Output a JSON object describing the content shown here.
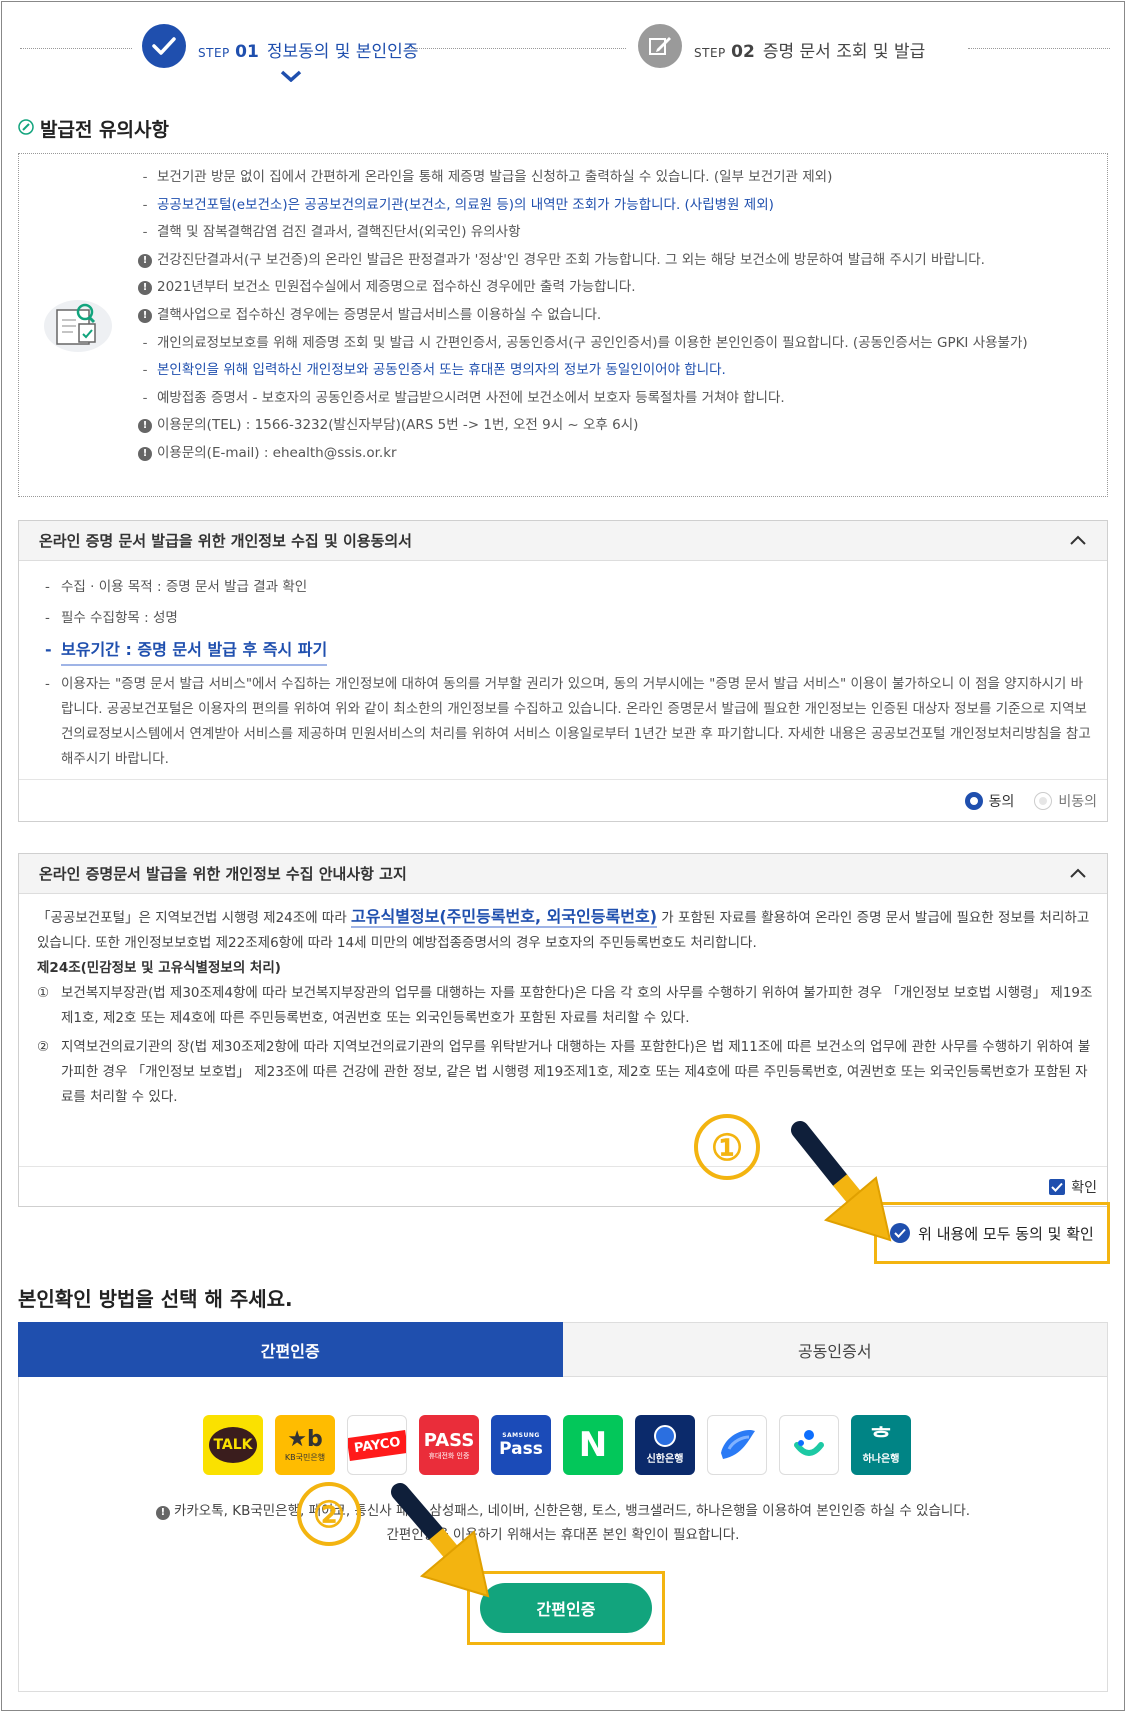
{
  "steps": [
    {
      "prefix": "STEP",
      "num": "01",
      "label": "정보동의 및 본인인증",
      "active": true
    },
    {
      "prefix": "STEP",
      "num": "02",
      "label": "증명 문서 조회 및 발급",
      "active": false
    }
  ],
  "notice": {
    "title": "발급전 유의사항",
    "items": [
      {
        "type": "dash",
        "text": "보건기관 방문 없이 집에서 간편하게 온라인을 통해 제증명 발급을 신청하고 출력하실 수 있습니다. (일부 보건기관 제외)"
      },
      {
        "type": "dash-blue",
        "text": "공공보건포털(e보건소)은 공공보건의료기관(보건소, 의료원 등)의 내역만 조회가 가능합니다. (사립병원 제외)"
      },
      {
        "type": "dash",
        "text": "결핵 및 잠복결핵감염 검진 결과서, 결핵진단서(외국인) 유의사항"
      },
      {
        "type": "alert",
        "text": "건강진단결과서(구 보건증)의 온라인 발급은 판정결과가 '정상'인 경우만 조회 가능합니다. 그 외는 해당 보건소에 방문하여 발급해 주시기 바랍니다."
      },
      {
        "type": "alert",
        "text": "2021년부터 보건소 민원접수실에서 제증명으로 접수하신 경우에만 출력 가능합니다."
      },
      {
        "type": "alert",
        "text": "결핵사업으로 접수하신 경우에는 증명문서 발급서비스를 이용하실 수 없습니다."
      },
      {
        "type": "dash",
        "text": "개인의료정보보호를 위해 제증명 조회 및 발급 시 간편인증서, 공동인증서(구 공인인증서)를 이용한 본인인증이 필요합니다. (공동인증서는 GPKI 사용불가)"
      },
      {
        "type": "dash-blue",
        "text": "본인확인을 위해 입력하신 개인정보와 공동인증서 또는 휴대폰 명의자의 정보가 동일인이어야 합니다."
      },
      {
        "type": "dash",
        "text": "예방접종 증명서 - 보호자의 공동인증서로 발급받으시려면 사전에 보건소에서 보호자 등록절차를 거쳐야 합니다."
      },
      {
        "type": "alert",
        "text": "이용문의(TEL) : 1566-3232(발신자부담)(ARS 5번 -> 1번, 오전 9시 ~ 오후 6시)"
      },
      {
        "type": "alert",
        "text": "이용문의(E-mail) : ehealth@ssis.or.kr"
      }
    ]
  },
  "consent": {
    "title": "온라인 증명 문서 발급을 위한 개인정보 수집 및 이용동의서",
    "items": [
      "수집 · 이용 목적 : 증명 문서 발급 결과 확인",
      "필수 수집항목 : 성명",
      "보유기간 : 증명 문서 발급 후 즉시 파기",
      "이용자는 \"증명 문서 발급 서비스\"에서 수집하는 개인정보에 대하여 동의를 거부할 권리가 있으며, 동의 거부시에는 \"증명 문서 발급 서비스\" 이용이 불가하오니 이 점을 양지하시기 바랍니다. 공공보건포털은 이용자의 편의를 위하여 위와 같이 최소한의 개인정보를 수집하고 있습니다. 온라인 증명문서 발급에 필요한 개인정보는 인증된 대상자 정보를 기준으로 지역보건의료정보시스템에서 연계받아 서비스를 제공하며 민원서비스의 처리를 위하여 서비스 이용일로부터 1년간 보관 후 파기합니다. 자세한 내용은 공공보건포털 개인정보처리방침을 참고해주시기 바랍니다."
    ],
    "agree_label": "동의",
    "disagree_label": "비동의"
  },
  "notice2": {
    "title": "온라인 증명문서 발급을 위한 개인정보 수집 안내사항 고지",
    "intro_a": "「공공보건포털」은 지역보건법 시행령 제24조에 따라 ",
    "intro_hl": "고유식별정보(주민등록번호, 외국인등록번호)",
    "intro_b": " 가 포함된 자료를 활용하여 온라인 증명 문서 발급에 필요한 정보를 처리하고 있습니다. 또한 개인정보보호법 제22조제6항에 따라 14세 미만의 예방접종증명서의 경우 보호자의 주민등록번호도 처리합니다.",
    "article": "제24조(민감정보 및 고유식별정보의 처리)",
    "items": [
      {
        "n": "①",
        "text": "보건복지부장관(법 제30조제4항에 따라 보건복지부장관의 업무를 대행하는 자를 포함한다)은 다음 각 호의 사무를 수행하기 위하여 불가피한 경우 「개인정보 보호법 시행령」 제19조제1호, 제2호 또는 제4호에 따른 주민등록번호, 여권번호 또는 외국인등록번호가 포함된 자료를 처리할 수 있다."
      },
      {
        "n": "②",
        "text": "지역보건의료기관의 장(법 제30조제2항에 따라 지역보건의료기관의 업무를 위탁받거나 대행하는 자를 포함한다)은 법 제11조에 따른 보건소의 업무에 관한 사무를 수행하기 위하여 불가피한 경우 「개인정보 보호법」 제23조에 따른 건강에 관한 정보, 같은 법 시행령 제19조제1호, 제2호 또는 제4호에 따른 주민등록번호, 여권번호 또는 외국인등록번호가 포함된 자료를 처리할 수 있다."
      }
    ],
    "confirm_label": "확인"
  },
  "agree_all_label": "위 내용에 모두 동의 및 확인",
  "auth": {
    "title": "본인확인 방법을 선택 해 주세요.",
    "tabs": [
      "간편인증",
      "공동인증서"
    ],
    "providers": [
      "TALK",
      "KB국민은행",
      "PAYCO",
      "PASS",
      "휴대전화 인증",
      "SAMSUNG",
      "Pass",
      "N",
      "신한은행",
      "하나은행"
    ],
    "note1": "카카오톡, KB국민은행, 페이코, 통신사 패스, 삼성패스, 네이버, 신한은행, 토스, 뱅크샐러드, 하나은행을 이용하여 본인인증 하실 수 있습니다.",
    "note2": "간편인증을 이용하기 위해서는 휴대폰 본인 확인이 필요합니다.",
    "button": "간편인증"
  },
  "annotations": [
    "①",
    "②"
  ],
  "colors": {
    "primary": "#1f4fae",
    "green": "#12a47d",
    "highlight": "#f3b410"
  }
}
